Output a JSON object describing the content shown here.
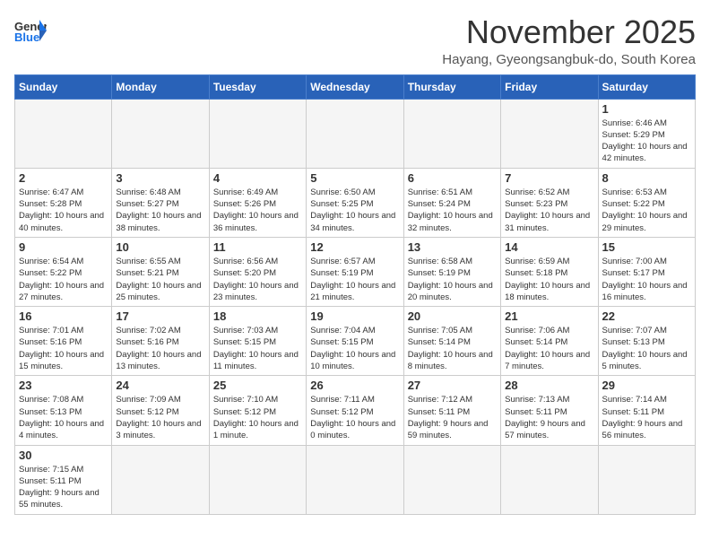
{
  "header": {
    "logo_general": "General",
    "logo_blue": "Blue",
    "month_title": "November 2025",
    "subtitle": "Hayang, Gyeongsangbuk-do, South Korea"
  },
  "weekdays": [
    "Sunday",
    "Monday",
    "Tuesday",
    "Wednesday",
    "Thursday",
    "Friday",
    "Saturday"
  ],
  "days": [
    {
      "num": "",
      "info": "",
      "empty": true
    },
    {
      "num": "",
      "info": "",
      "empty": true
    },
    {
      "num": "",
      "info": "",
      "empty": true
    },
    {
      "num": "",
      "info": "",
      "empty": true
    },
    {
      "num": "",
      "info": "",
      "empty": true
    },
    {
      "num": "",
      "info": "",
      "empty": true
    },
    {
      "num": "1",
      "info": "Sunrise: 6:46 AM\nSunset: 5:29 PM\nDaylight: 10 hours and 42 minutes.",
      "empty": false
    },
    {
      "num": "2",
      "info": "Sunrise: 6:47 AM\nSunset: 5:28 PM\nDaylight: 10 hours and 40 minutes.",
      "empty": false
    },
    {
      "num": "3",
      "info": "Sunrise: 6:48 AM\nSunset: 5:27 PM\nDaylight: 10 hours and 38 minutes.",
      "empty": false
    },
    {
      "num": "4",
      "info": "Sunrise: 6:49 AM\nSunset: 5:26 PM\nDaylight: 10 hours and 36 minutes.",
      "empty": false
    },
    {
      "num": "5",
      "info": "Sunrise: 6:50 AM\nSunset: 5:25 PM\nDaylight: 10 hours and 34 minutes.",
      "empty": false
    },
    {
      "num": "6",
      "info": "Sunrise: 6:51 AM\nSunset: 5:24 PM\nDaylight: 10 hours and 32 minutes.",
      "empty": false
    },
    {
      "num": "7",
      "info": "Sunrise: 6:52 AM\nSunset: 5:23 PM\nDaylight: 10 hours and 31 minutes.",
      "empty": false
    },
    {
      "num": "8",
      "info": "Sunrise: 6:53 AM\nSunset: 5:22 PM\nDaylight: 10 hours and 29 minutes.",
      "empty": false
    },
    {
      "num": "9",
      "info": "Sunrise: 6:54 AM\nSunset: 5:22 PM\nDaylight: 10 hours and 27 minutes.",
      "empty": false
    },
    {
      "num": "10",
      "info": "Sunrise: 6:55 AM\nSunset: 5:21 PM\nDaylight: 10 hours and 25 minutes.",
      "empty": false
    },
    {
      "num": "11",
      "info": "Sunrise: 6:56 AM\nSunset: 5:20 PM\nDaylight: 10 hours and 23 minutes.",
      "empty": false
    },
    {
      "num": "12",
      "info": "Sunrise: 6:57 AM\nSunset: 5:19 PM\nDaylight: 10 hours and 21 minutes.",
      "empty": false
    },
    {
      "num": "13",
      "info": "Sunrise: 6:58 AM\nSunset: 5:19 PM\nDaylight: 10 hours and 20 minutes.",
      "empty": false
    },
    {
      "num": "14",
      "info": "Sunrise: 6:59 AM\nSunset: 5:18 PM\nDaylight: 10 hours and 18 minutes.",
      "empty": false
    },
    {
      "num": "15",
      "info": "Sunrise: 7:00 AM\nSunset: 5:17 PM\nDaylight: 10 hours and 16 minutes.",
      "empty": false
    },
    {
      "num": "16",
      "info": "Sunrise: 7:01 AM\nSunset: 5:16 PM\nDaylight: 10 hours and 15 minutes.",
      "empty": false
    },
    {
      "num": "17",
      "info": "Sunrise: 7:02 AM\nSunset: 5:16 PM\nDaylight: 10 hours and 13 minutes.",
      "empty": false
    },
    {
      "num": "18",
      "info": "Sunrise: 7:03 AM\nSunset: 5:15 PM\nDaylight: 10 hours and 11 minutes.",
      "empty": false
    },
    {
      "num": "19",
      "info": "Sunrise: 7:04 AM\nSunset: 5:15 PM\nDaylight: 10 hours and 10 minutes.",
      "empty": false
    },
    {
      "num": "20",
      "info": "Sunrise: 7:05 AM\nSunset: 5:14 PM\nDaylight: 10 hours and 8 minutes.",
      "empty": false
    },
    {
      "num": "21",
      "info": "Sunrise: 7:06 AM\nSunset: 5:14 PM\nDaylight: 10 hours and 7 minutes.",
      "empty": false
    },
    {
      "num": "22",
      "info": "Sunrise: 7:07 AM\nSunset: 5:13 PM\nDaylight: 10 hours and 5 minutes.",
      "empty": false
    },
    {
      "num": "23",
      "info": "Sunrise: 7:08 AM\nSunset: 5:13 PM\nDaylight: 10 hours and 4 minutes.",
      "empty": false
    },
    {
      "num": "24",
      "info": "Sunrise: 7:09 AM\nSunset: 5:12 PM\nDaylight: 10 hours and 3 minutes.",
      "empty": false
    },
    {
      "num": "25",
      "info": "Sunrise: 7:10 AM\nSunset: 5:12 PM\nDaylight: 10 hours and 1 minute.",
      "empty": false
    },
    {
      "num": "26",
      "info": "Sunrise: 7:11 AM\nSunset: 5:12 PM\nDaylight: 10 hours and 0 minutes.",
      "empty": false
    },
    {
      "num": "27",
      "info": "Sunrise: 7:12 AM\nSunset: 5:11 PM\nDaylight: 9 hours and 59 minutes.",
      "empty": false
    },
    {
      "num": "28",
      "info": "Sunrise: 7:13 AM\nSunset: 5:11 PM\nDaylight: 9 hours and 57 minutes.",
      "empty": false
    },
    {
      "num": "29",
      "info": "Sunrise: 7:14 AM\nSunset: 5:11 PM\nDaylight: 9 hours and 56 minutes.",
      "empty": false
    },
    {
      "num": "30",
      "info": "Sunrise: 7:15 AM\nSunset: 5:11 PM\nDaylight: 9 hours and 55 minutes.",
      "empty": false
    },
    {
      "num": "",
      "info": "",
      "empty": true
    },
    {
      "num": "",
      "info": "",
      "empty": true
    },
    {
      "num": "",
      "info": "",
      "empty": true
    },
    {
      "num": "",
      "info": "",
      "empty": true
    },
    {
      "num": "",
      "info": "",
      "empty": true
    },
    {
      "num": "",
      "info": "",
      "empty": true
    }
  ]
}
